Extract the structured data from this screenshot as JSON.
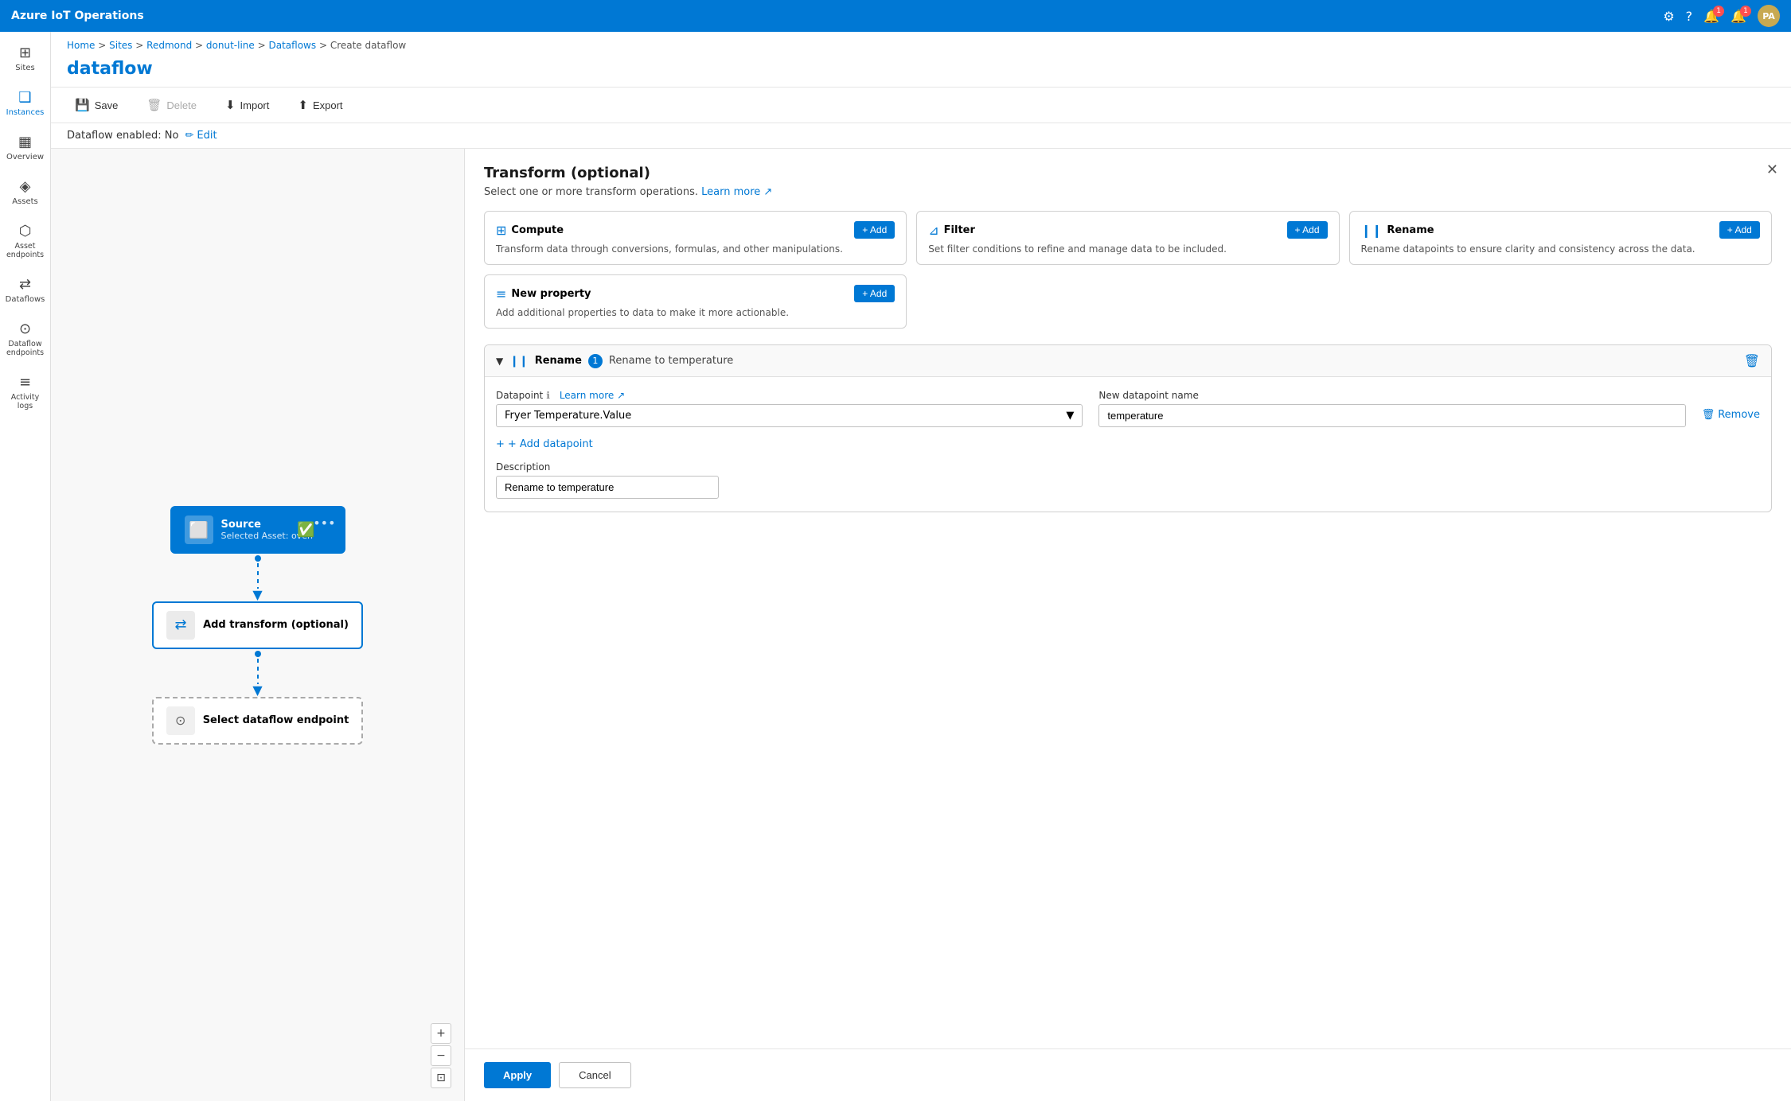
{
  "app": {
    "title": "Azure IoT Operations"
  },
  "breadcrumb": {
    "items": [
      "Home",
      "Sites",
      "Redmond",
      "donut-line",
      "Dataflows",
      "Create dataflow"
    ]
  },
  "page": {
    "title": "dataflow"
  },
  "toolbar": {
    "save": "Save",
    "delete": "Delete",
    "import": "Import",
    "export": "Export"
  },
  "dataflow_status": {
    "label": "Dataflow enabled: No",
    "edit": "Edit"
  },
  "sidebar": {
    "items": [
      {
        "id": "sites",
        "label": "Sites",
        "icon": "⊞"
      },
      {
        "id": "instances",
        "label": "Instances",
        "icon": "❑"
      },
      {
        "id": "overview",
        "label": "Overview",
        "icon": "▦"
      },
      {
        "id": "assets",
        "label": "Assets",
        "icon": "◈"
      },
      {
        "id": "asset-endpoints",
        "label": "Asset endpoints",
        "icon": "⬡"
      },
      {
        "id": "dataflows",
        "label": "Dataflows",
        "icon": "⇄"
      },
      {
        "id": "dataflow-endpoints",
        "label": "Dataflow endpoints",
        "icon": "⊙"
      },
      {
        "id": "activity-logs",
        "label": "Activity logs",
        "icon": "≡"
      }
    ]
  },
  "canvas": {
    "source_node": {
      "title": "Source",
      "subtitle": "Selected Asset: oven"
    },
    "transform_node": {
      "title": "Add transform (optional)"
    },
    "endpoint_node": {
      "title": "Select dataflow endpoint"
    }
  },
  "panel": {
    "title": "Transform (optional)",
    "subtitle": "Select one or more transform operations.",
    "learn_more": "Learn more",
    "transforms": [
      {
        "id": "compute",
        "icon": "⊞",
        "title": "Compute",
        "description": "Transform data through conversions, formulas, and other manipulations.",
        "add_label": "+ Add"
      },
      {
        "id": "filter",
        "icon": "⊿",
        "title": "Filter",
        "description": "Set filter conditions to refine and manage data to be included.",
        "add_label": "+ Add"
      },
      {
        "id": "rename",
        "icon": "❙❙",
        "title": "Rename",
        "description": "Rename datapoints to ensure clarity and consistency across the data.",
        "add_label": "+ Add"
      },
      {
        "id": "new-property",
        "icon": "≡",
        "title": "New property",
        "description": "Add additional properties to data to make it more actionable.",
        "add_label": "+ Add"
      }
    ],
    "rename_section": {
      "label": "Rename",
      "badge": "1",
      "subtitle": "Rename to temperature",
      "datapoint_label": "Datapoint",
      "datapoint_learn_more": "Learn more",
      "datapoint_value": "Fryer Temperature.Value",
      "new_name_label": "New datapoint name",
      "new_name_value": "temperature",
      "remove_label": "Remove",
      "add_datapoint": "+ Add datapoint",
      "desc_label": "Description",
      "desc_value": "Rename to temperature"
    },
    "apply_label": "Apply",
    "cancel_label": "Cancel"
  }
}
